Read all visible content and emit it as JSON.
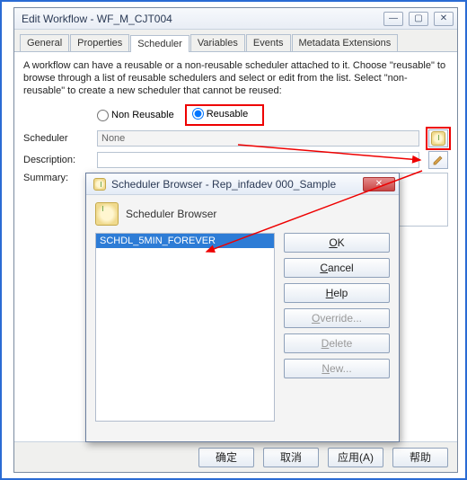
{
  "window": {
    "title": "Edit Workflow - WF_M_CJT004",
    "sysbuttons": {
      "min": "—",
      "max": "▢",
      "close": "✕"
    }
  },
  "tabs": [
    "General",
    "Properties",
    "Scheduler",
    "Variables",
    "Events",
    "Metadata Extensions"
  ],
  "active_tab_index": 2,
  "intro": "A workflow can have a reusable or a non-reusable scheduler attached to it.  Choose \"reusable\" to browse through a list of reusable schedulers and select or edit from the list.  Select \"non-reusable\" to create a new scheduler that cannot be reused:",
  "radios": {
    "non_reusable": "Non Reusable",
    "reusable": "Reusable"
  },
  "labels": {
    "scheduler": "Scheduler",
    "description": "Description:",
    "summary": "Summary:"
  },
  "scheduler_value": "None",
  "footer": {
    "ok": "确定",
    "cancel": "取消",
    "apply": "应用(A)",
    "help": "帮助"
  },
  "dialog": {
    "title": "Scheduler Browser - Rep_infadev 000_Sample",
    "subtitle": "Scheduler Browser",
    "list": [
      "SCHDL_5MIN_FOREVER"
    ],
    "buttons": {
      "ok_prefix": "O",
      "ok_rest": "K",
      "cancel_prefix": "C",
      "cancel_rest": "ancel",
      "help_prefix": "H",
      "help_rest": "elp",
      "override_prefix": "O",
      "override_rest": "verride...",
      "delete_prefix": "D",
      "delete_rest": "elete",
      "new_prefix": "N",
      "new_rest": "ew..."
    }
  }
}
